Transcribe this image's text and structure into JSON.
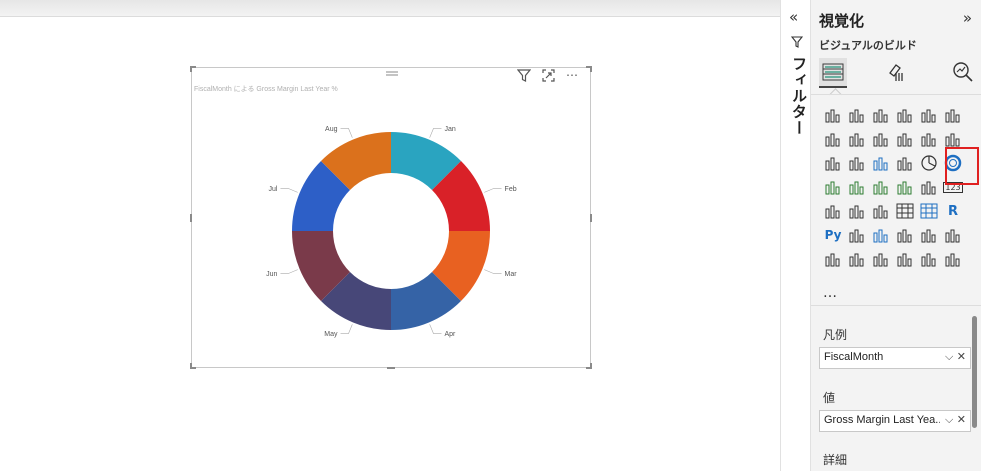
{
  "visual": {
    "title": "FiscalMonth による Gross Margin Last Year %",
    "tools": {
      "filter_icon": "filter-icon",
      "focus_icon": "focus-mode-icon",
      "more": "⋯"
    }
  },
  "chart_data": {
    "type": "pie",
    "variant": "donut",
    "categories": [
      "Jan",
      "Feb",
      "Mar",
      "Apr",
      "May",
      "Jun",
      "Jul",
      "Aug"
    ],
    "values": [
      12.5,
      12.5,
      12.5,
      12.5,
      12.5,
      12.5,
      12.5,
      12.5
    ],
    "colors": [
      "#2aa4c0",
      "#d92128",
      "#e86121",
      "#3563a6",
      "#474778",
      "#7a3a4a",
      "#2d5fc7",
      "#db711c"
    ],
    "legend": "none"
  },
  "filters": {
    "collapse": "«",
    "label": "フィルター"
  },
  "viz": {
    "title": "視覚化",
    "expand": "»",
    "subtitle": "ビジュアルのビルド",
    "more": "…",
    "legend_label": "凡例",
    "legend_field": "FiscalMonth",
    "values_label": "値",
    "values_field": "Gross Margin Last Yea...",
    "details_label": "詳細",
    "well_controls": "⌵ ✕"
  }
}
